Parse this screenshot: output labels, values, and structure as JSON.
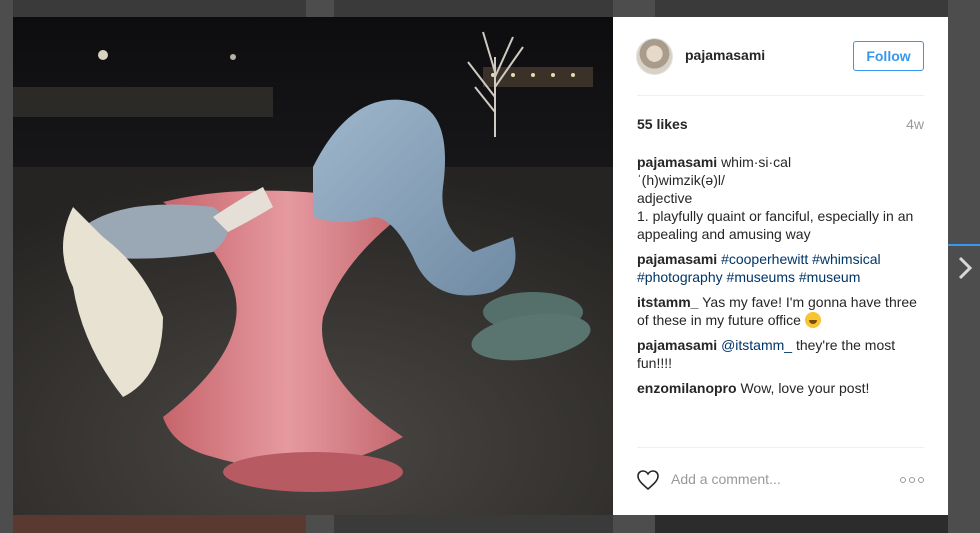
{
  "post": {
    "username": "pajamasami",
    "follow_label": "Follow",
    "likes": "55 likes",
    "time": "4w",
    "comments": [
      {
        "user": "pajamasami",
        "lines": [
          "whim·si·cal",
          "ˈ(h)wimzik(ə)l/",
          "adjective",
          "1. playfully quaint or fanciful, especially in an appealing and amusing way"
        ]
      },
      {
        "user": "pajamasami",
        "tags": [
          "#cooperhewitt",
          "#whimsical",
          "#photography",
          "#museums",
          "#museum"
        ]
      },
      {
        "user": "itstamm_",
        "text": "Yas my fave! I'm gonna have three of these in my future office"
      },
      {
        "user": "pajamasami",
        "mention": "@itstamm_",
        "text": "they're the most fun!!!!"
      },
      {
        "user": "enzomilanopro",
        "text": "Wow, love your post!"
      }
    ],
    "add_comment_placeholder": "Add a comment...",
    "icons": {
      "like": "heart-icon",
      "more": "more-options-icon",
      "next": "chevron-right-icon",
      "emoji": "tears-of-joy-emoji"
    }
  },
  "colors": {
    "accent": "#3897f0",
    "hashtag": "#003569",
    "muted": "#999999",
    "text": "#262626"
  }
}
